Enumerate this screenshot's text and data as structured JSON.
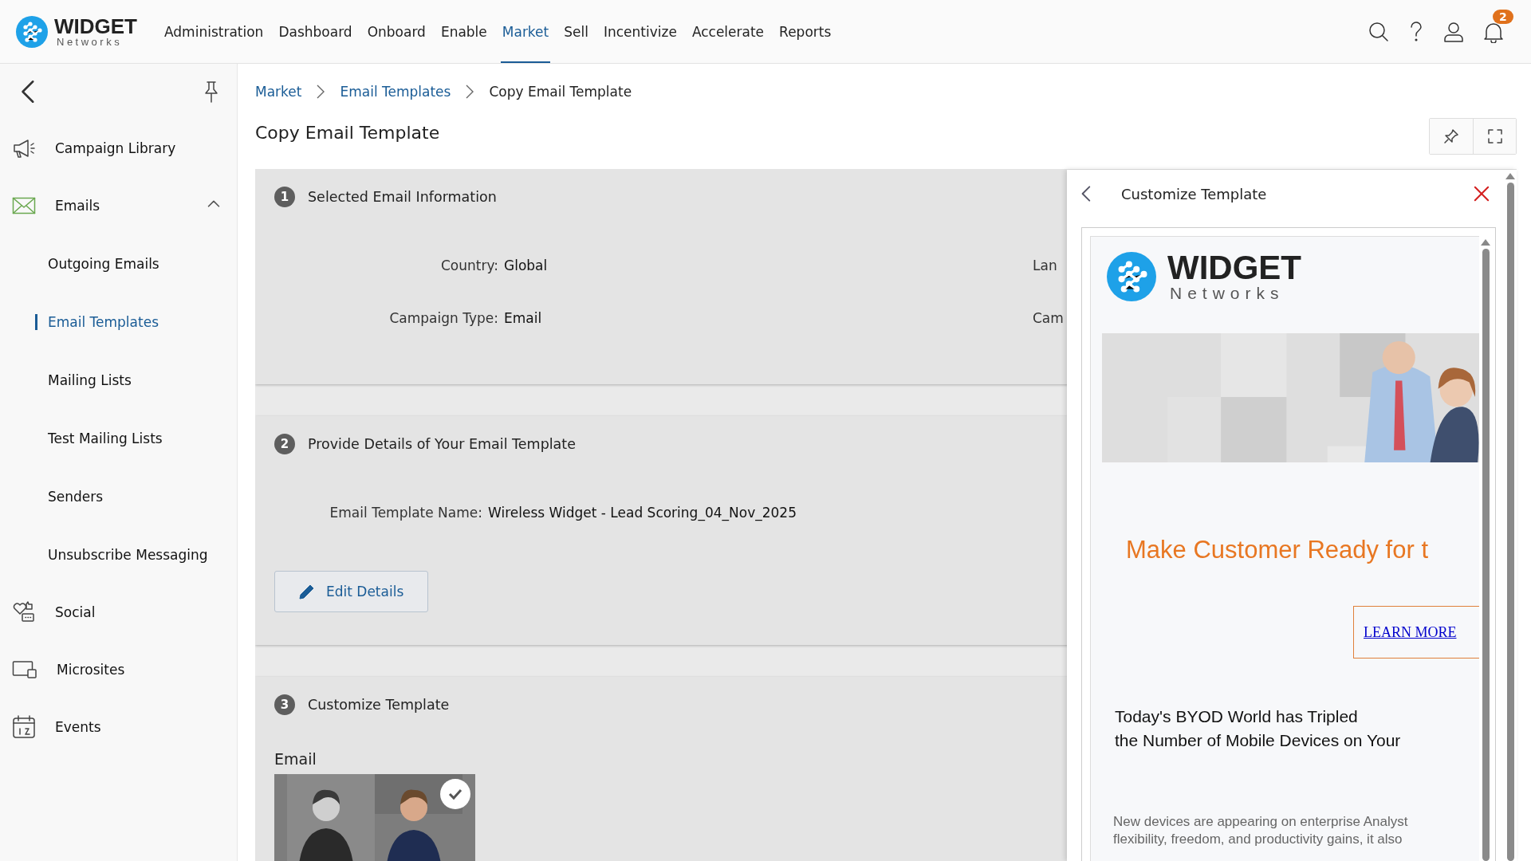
{
  "header": {
    "brand": {
      "name": "WIDGET",
      "tagline": "Networks"
    },
    "nav": [
      {
        "label": "Administration",
        "selected": false
      },
      {
        "label": "Dashboard",
        "selected": false
      },
      {
        "label": "Onboard",
        "selected": false
      },
      {
        "label": "Enable",
        "selected": false
      },
      {
        "label": "Market",
        "selected": true
      },
      {
        "label": "Sell",
        "selected": false
      },
      {
        "label": "Incentivize",
        "selected": false
      },
      {
        "label": "Accelerate",
        "selected": false
      },
      {
        "label": "Reports",
        "selected": false
      }
    ],
    "notifications": {
      "count": "2"
    }
  },
  "sidebar": {
    "items": [
      {
        "label": "Campaign Library"
      },
      {
        "label": "Emails",
        "expanded": true,
        "children": [
          {
            "label": "Outgoing Emails",
            "selected": false
          },
          {
            "label": "Email Templates",
            "selected": true
          },
          {
            "label": "Mailing Lists",
            "selected": false
          },
          {
            "label": "Test Mailing Lists",
            "selected": false
          },
          {
            "label": "Senders",
            "selected": false
          },
          {
            "label": "Unsubscribe Messaging",
            "selected": false
          }
        ]
      },
      {
        "label": "Social"
      },
      {
        "label": "Microsites"
      },
      {
        "label": "Events"
      }
    ]
  },
  "breadcrumb": [
    {
      "label": "Market",
      "link": true
    },
    {
      "label": "Email Templates",
      "link": true
    },
    {
      "label": "Copy Email Template",
      "link": false
    }
  ],
  "page_title": "Copy Email Template",
  "sections": [
    {
      "number": "1",
      "title": "Selected Email Information",
      "fields": [
        {
          "label": "Country:",
          "value": "Global",
          "side_label": "Lan"
        },
        {
          "label": "Campaign Type:",
          "value": "Email",
          "side_label": "Cam"
        }
      ]
    },
    {
      "number": "2",
      "title": "Provide Details of Your Email Template",
      "fields": [
        {
          "label": "Email Template Name:",
          "value": "Wireless Widget - Lead Scoring_04_Nov_2025"
        }
      ],
      "button": "Edit Details"
    },
    {
      "number": "3",
      "title": "Customize Template",
      "subheading": "Email",
      "thumbnail": {
        "kind": "picture",
        "checked": true
      }
    }
  ],
  "panel": {
    "title": "Customize Template",
    "preview": {
      "brand": {
        "name": "WIDGET",
        "tagline": "Networks"
      },
      "banner": {
        "kind": "picture"
      },
      "headline": "Make Customer Ready for t",
      "button": "LEARN MORE",
      "subheading_lines": [
        "Today's BYOD World has Tripled",
        "the Number of Mobile Devices on Your"
      ],
      "body_lines": [
        "New devices are appearing on enterprise Analyst",
        "flexibility, freedom, and productivity gains, it also"
      ]
    }
  }
}
